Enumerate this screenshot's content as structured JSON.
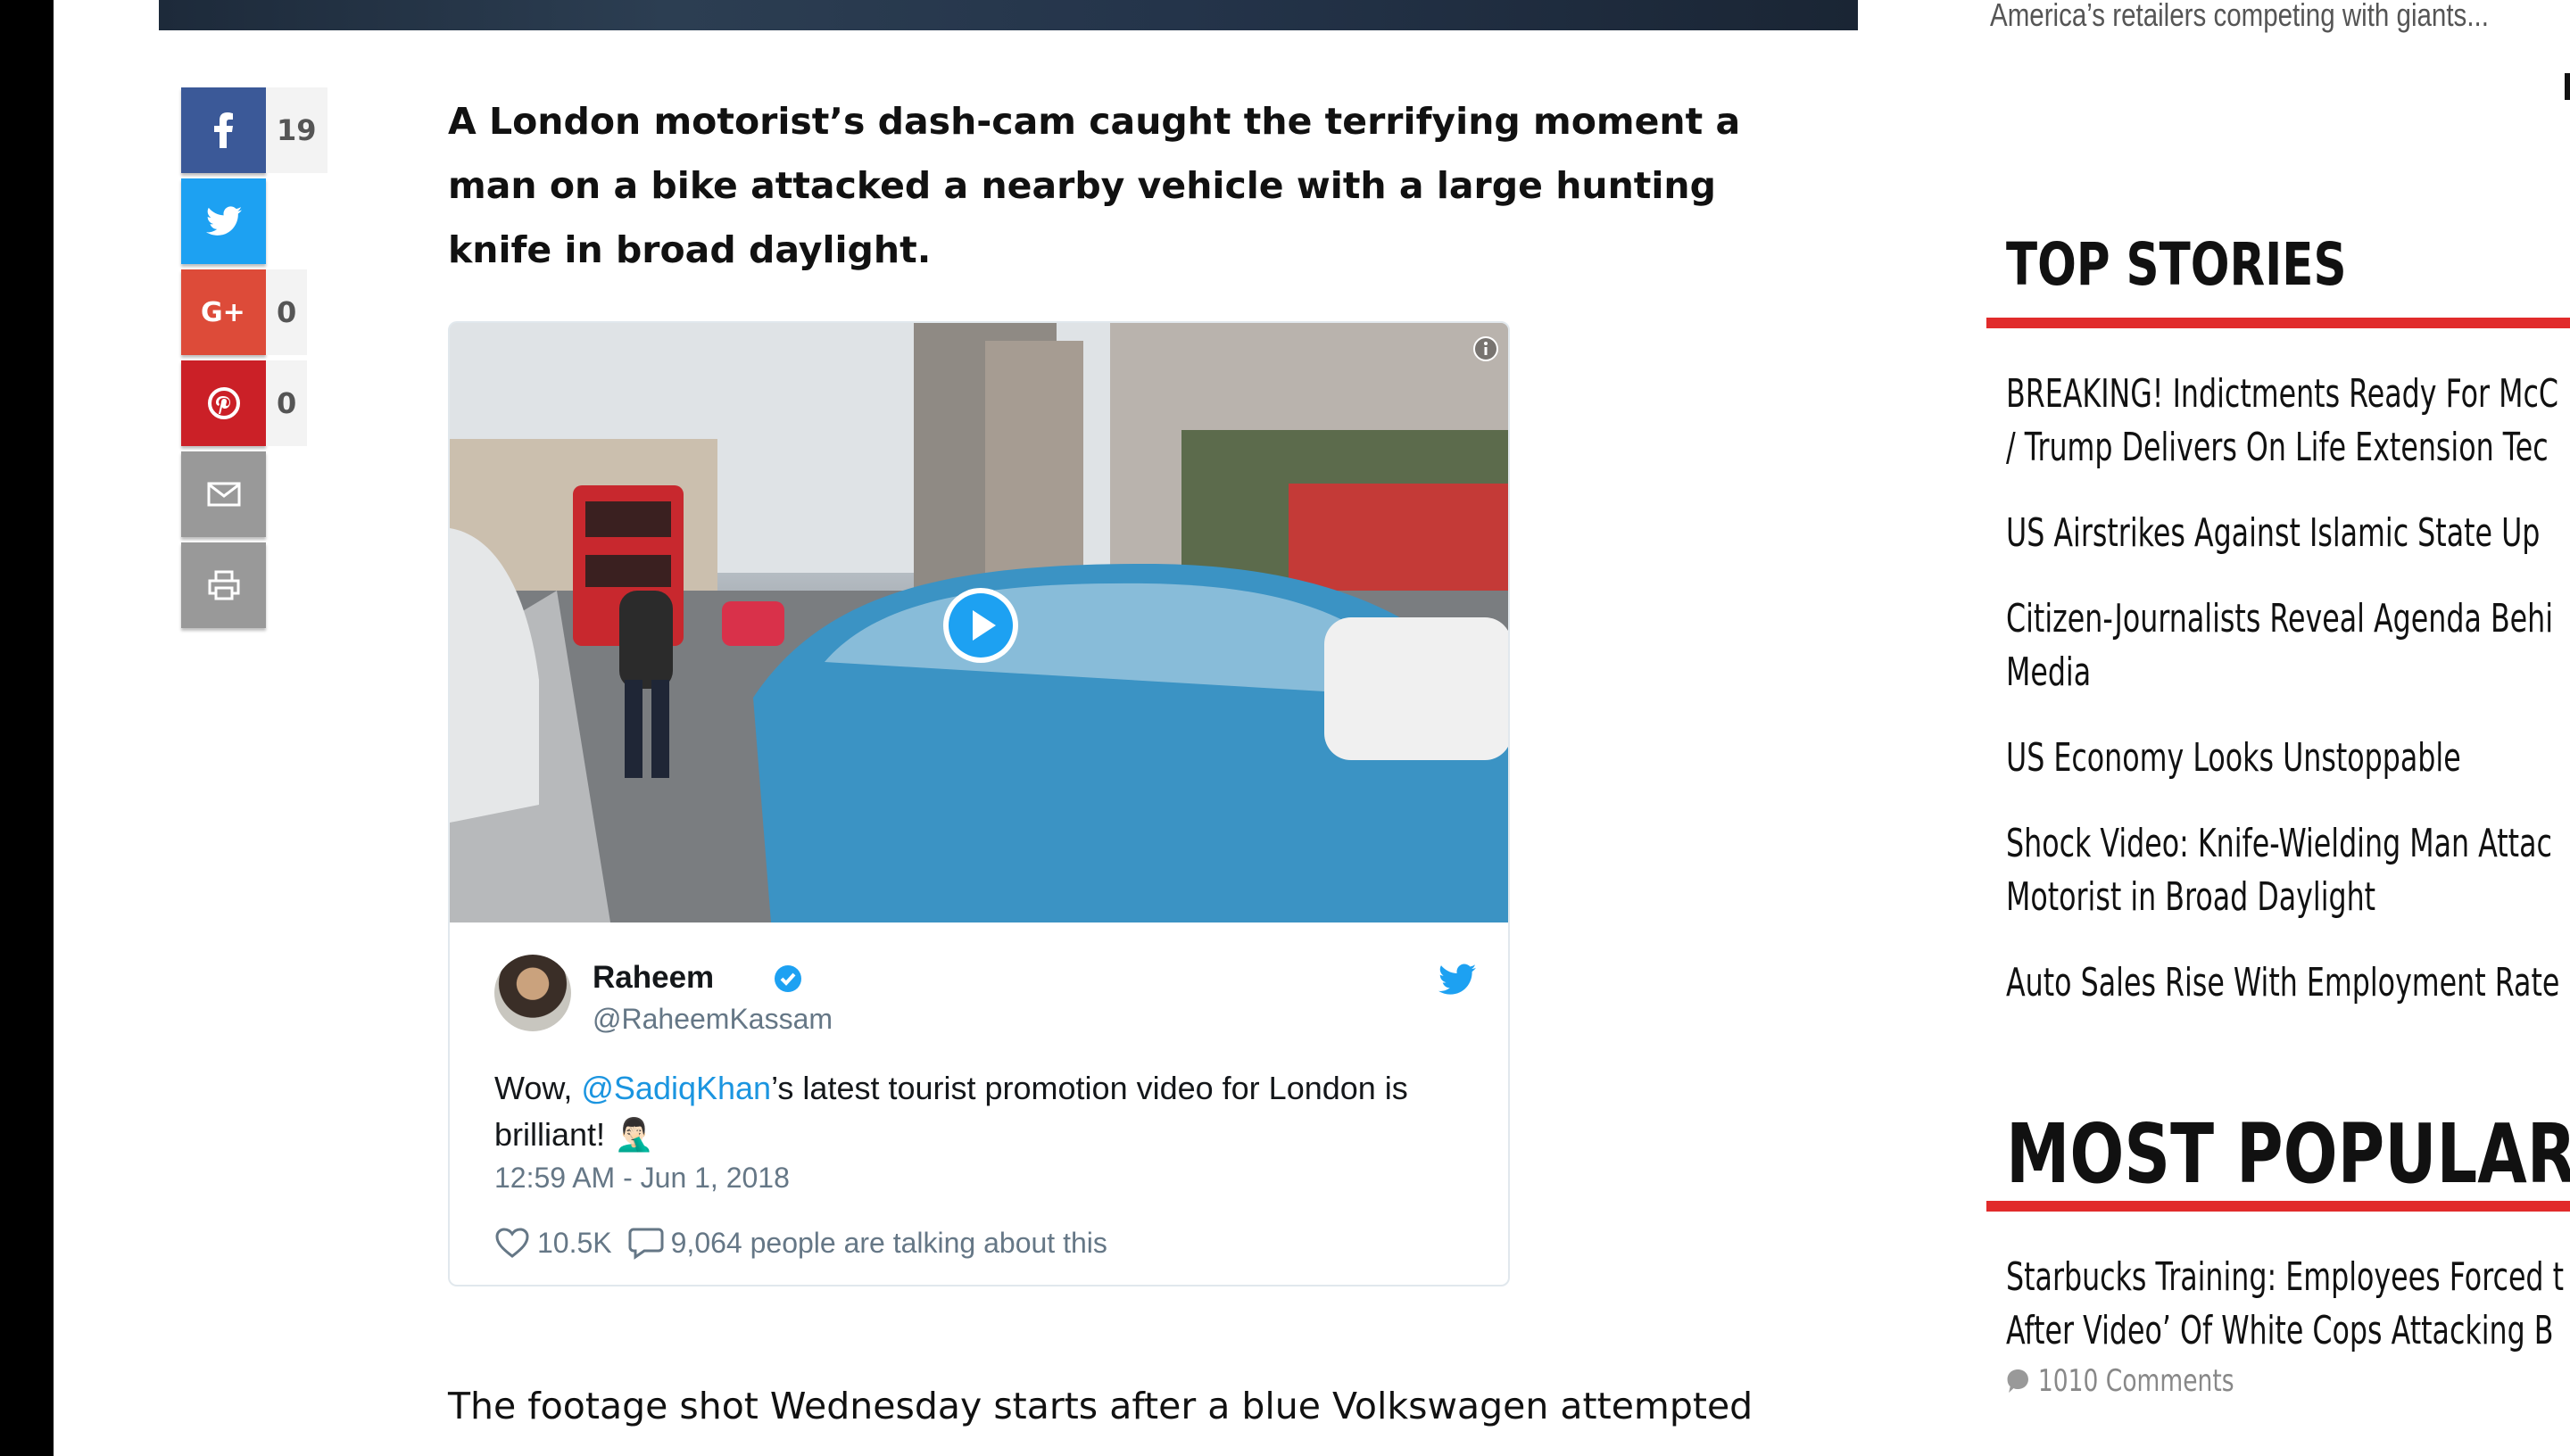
{
  "share_bar": {
    "facebook": {
      "icon": "facebook-icon",
      "count": "19"
    },
    "twitter": {
      "icon": "twitter-icon"
    },
    "googleplus": {
      "icon": "google-plus-icon",
      "count": "0"
    },
    "pinterest": {
      "icon": "pinterest-icon",
      "count": "0"
    },
    "email": {
      "icon": "mail-icon"
    },
    "print": {
      "icon": "print-icon"
    }
  },
  "article": {
    "lede": "A London motorist’s dash-cam caught the terrifying moment a man on a bike attacked a nearby vehicle with a large hunting knife in broad daylight.",
    "body_first_line": "The footage shot Wednesday starts after a blue Volkswagen attempted"
  },
  "tweet": {
    "name": "Raheem",
    "handle": "@RaheemKassam",
    "text_before": "Wow, ",
    "mention": "@SadiqKhan",
    "text_after": "’s latest tourist promotion video for London is brilliant! 🤦🏻‍♂️",
    "timestamp": "12:59 AM - Jun 1, 2018",
    "likes": "10.5K",
    "talking": "9,064 people are talking about this"
  },
  "sidebar": {
    "top_text": "America’s retailers competing with giants...",
    "top_stories_title": "TOP STORIES",
    "top_stories": [
      "BREAKING! Indictments Ready For McC",
      "/ Trump Delivers On Life Extension Tec",
      "US Airstrikes Against Islamic State Up",
      "Citizen-Journalists Reveal Agenda Behi",
      "Media",
      "US Economy Looks Unstoppable",
      "Shock Video: Knife-Wielding Man Attac",
      "Motorist in Broad Daylight",
      "Auto Sales Rise With Employment Rate"
    ],
    "most_popular_title": "MOST POPULAR",
    "most_popular": [
      {
        "title_line1": "Starbucks Training: Employees Forced t",
        "title_line2": "After Video’ Of White Cops Attacking B",
        "comments": "1010 Comments"
      }
    ]
  },
  "colors": {
    "facebook": "#3b5998",
    "twitter": "#1da1f2",
    "google_plus": "#dd4b39",
    "pinterest": "#cb2027",
    "section_bar": "#e12b2b",
    "mention": "#1b95e0"
  }
}
